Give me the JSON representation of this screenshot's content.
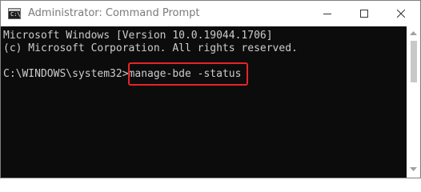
{
  "window": {
    "title": "Administrator: Command Prompt",
    "app_icon": "command-prompt-icon",
    "controls": {
      "minimize_icon": "minimize-icon",
      "maximize_icon": "maximize-icon",
      "close_icon": "close-icon"
    }
  },
  "console": {
    "lines": [
      "Microsoft Windows [Version 10.0.19044.1706]",
      "(c) Microsoft Corporation. All rights reserved."
    ],
    "prompt": "C:\\WINDOWS\\system32>",
    "command": "manage-bde -status",
    "text_color": "#cccccc",
    "background": "#0c0c0c",
    "highlight_color": "#e8232a"
  },
  "scrollbar": {
    "up_icon": "scroll-up-arrow-icon",
    "down_icon": "scroll-down-arrow-icon"
  }
}
